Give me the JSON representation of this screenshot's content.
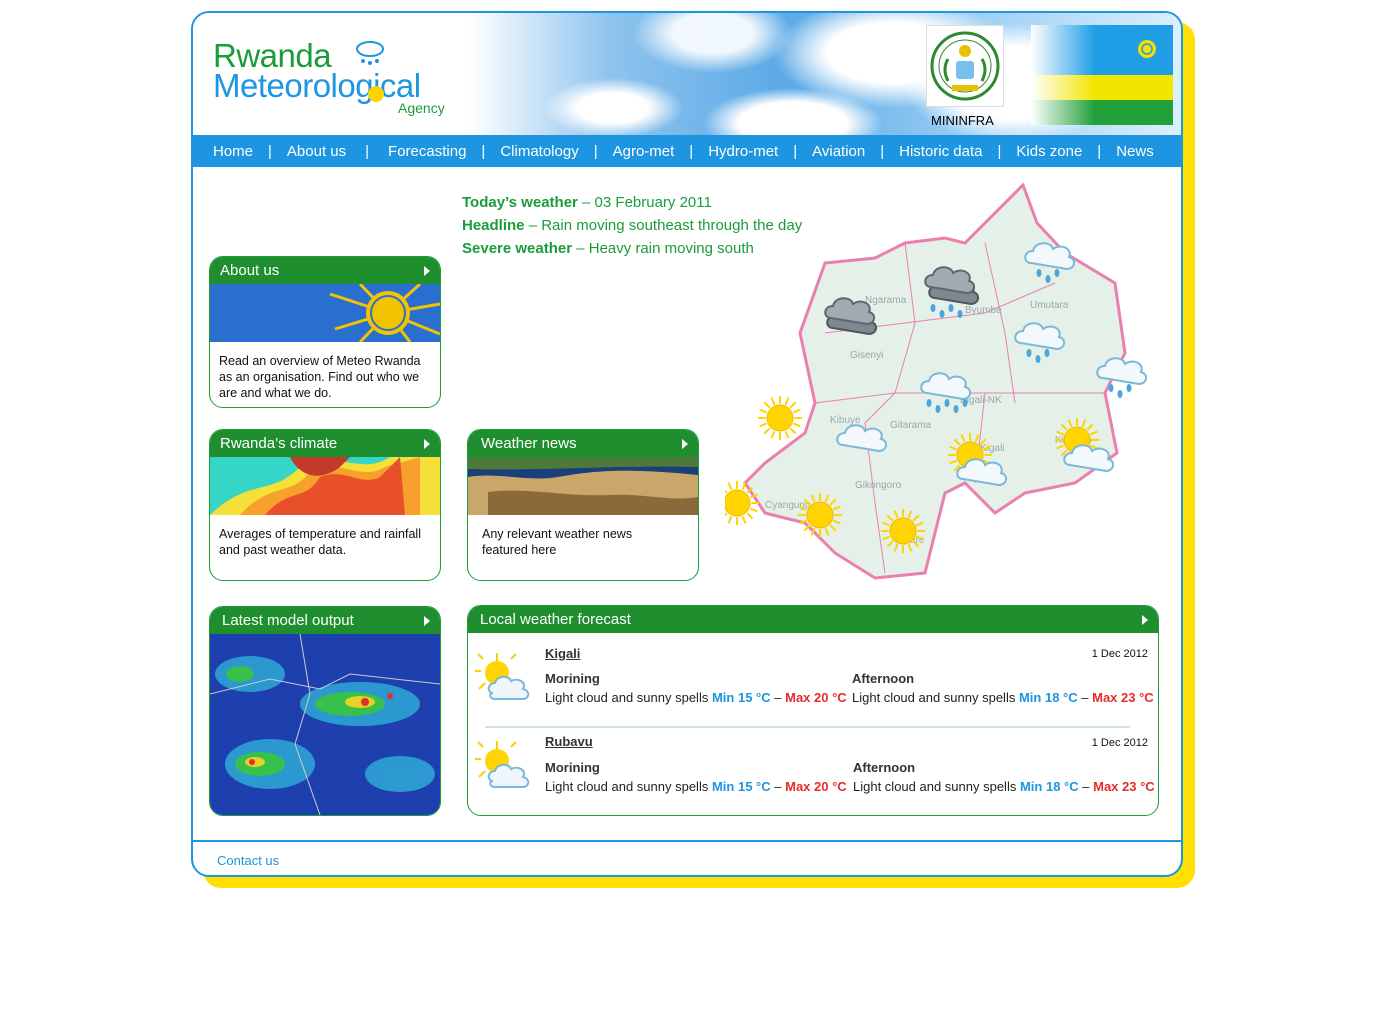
{
  "header": {
    "logo_line1": "Rwanda",
    "logo_line2": "Meteorological",
    "logo_line3": "Agency",
    "ministry": "MININFRA"
  },
  "nav": [
    "Home",
    "About us",
    "Forecasting",
    "Climatology",
    "Agro-met",
    "Hydro-met",
    "Aviation",
    "Historic data",
    "Kids zone",
    "News"
  ],
  "today": {
    "weather_label": "Today’s weather",
    "weather_value": " – 03 February 2011",
    "headline_label": "Headline",
    "headline_value": " – Rain moving southeast through the day",
    "severe_label": "Severe weather",
    "severe_value": " – Heavy rain moving south"
  },
  "boxes": {
    "about": {
      "title": "About us",
      "text": "Read an overview of Meteo Rwanda as an organisation. Find out who we are and what we do."
    },
    "climate": {
      "title": "Rwanda’s climate",
      "text": "Averages of temperature and rainfall and past weather data."
    },
    "news": {
      "title": "Weather news",
      "text": "Any relevant weather news featured here"
    },
    "model": {
      "title": "Latest model output"
    }
  },
  "map": {
    "regions": [
      "Ngarama",
      "Byumba",
      "Umutara",
      "Gisenyi",
      "Kibuye",
      "Gitarama",
      "Kigali",
      "Kigali-NK",
      "Gikongoro",
      "Butare",
      "Cyangugu",
      "Kibungo"
    ]
  },
  "forecast": {
    "title": "Local weather forecast",
    "rows": [
      {
        "location": "Kigali",
        "date": "1 Dec 2012",
        "morning": {
          "label": "Morining",
          "desc": "Light cloud and sunny spells",
          "min": "Min 15 °C",
          "max": "Max 20 °C"
        },
        "afternoon": {
          "label": "Afternoon",
          "desc": "Light cloud and sunny spells",
          "min": "Min 18 °C",
          "max": "Max 23 °C"
        }
      },
      {
        "location": "Rubavu",
        "date": "1 Dec 2012",
        "morning": {
          "label": "Morining",
          "desc": "Light cloud and sunny spells",
          "min": "Min 15 °C",
          "max": "Max 20 °C"
        },
        "afternoon": {
          "label": "Afternoon",
          "desc": "Light cloud and sunny spells",
          "min": "Min 18 °C",
          "max": "Max 23 °C"
        }
      }
    ],
    "dash": "–"
  },
  "footer": {
    "contact": "Contact us"
  },
  "colors": {
    "blue": "#1d95e0",
    "green": "#1b9c3c",
    "yellow": "#ffe000",
    "red": "#e62b2b"
  }
}
